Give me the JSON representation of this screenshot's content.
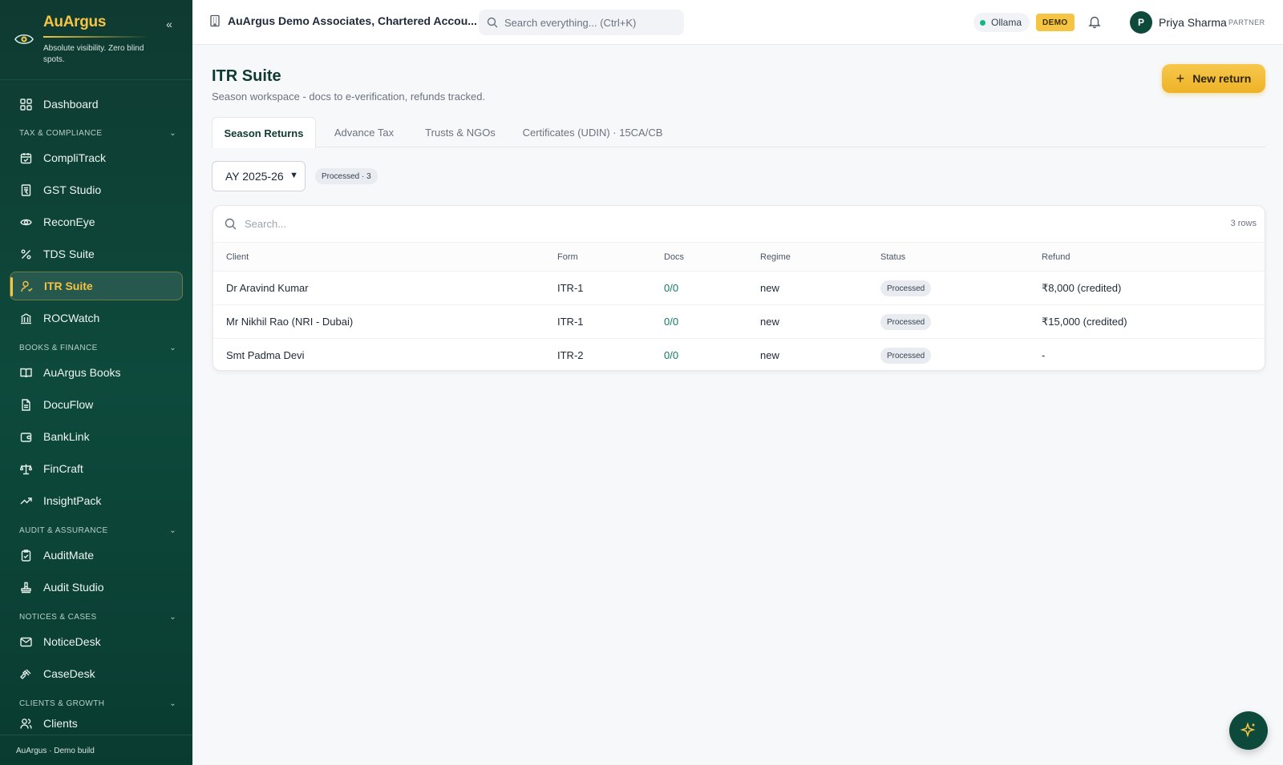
{
  "brand": {
    "name": "AuArgus",
    "tagline": "Absolute visibility. Zero blind spots.",
    "accent": "#f6c443",
    "sidebar_bg": "#0e4a3c"
  },
  "sidebar": {
    "dashboard": "Dashboard",
    "sections": [
      {
        "label": "TAX & COMPLIANCE",
        "items": [
          "CompliTrack",
          "GST Studio",
          "ReconEye",
          "TDS Suite",
          "ITR Suite",
          "ROCWatch"
        ]
      },
      {
        "label": "BOOKS & FINANCE",
        "items": [
          "AuArgus Books",
          "DocuFlow",
          "BankLink",
          "FinCraft",
          "InsightPack"
        ]
      },
      {
        "label": "AUDIT & ASSURANCE",
        "items": [
          "AuditMate",
          "Audit Studio"
        ]
      },
      {
        "label": "NOTICES & CASES",
        "items": [
          "NoticeDesk",
          "CaseDesk"
        ]
      },
      {
        "label": "CLIENTS & GROWTH",
        "items": [
          "Clients"
        ]
      }
    ],
    "active": "ITR Suite",
    "footer": "AuArgus · Demo build"
  },
  "topbar": {
    "org": "AuArgus Demo Associates, Chartered Accou...",
    "search_placeholder": "Search everything...  (Ctrl+K)",
    "ollama": "Ollama",
    "demo": "DEMO",
    "avatar_initial": "P",
    "user_name": "Priya Sharma",
    "user_role": "PARTNER"
  },
  "main": {
    "title": "ITR Suite",
    "subtitle": "Season workspace - docs to e-verification, refunds tracked.",
    "new_button": "New return",
    "tabs": [
      "Season Returns",
      "Advance Tax",
      "Trusts & NGOs",
      "Certificates (UDIN) · 15CA/CB"
    ],
    "active_tab": "Season Returns",
    "ay_select": "AY 2025-26",
    "processed_chip": "Processed · 3"
  },
  "table": {
    "search_placeholder": "Search...",
    "row_count": "3 rows",
    "columns": [
      "Client",
      "Form",
      "Docs",
      "Regime",
      "Status",
      "Refund"
    ],
    "rows": [
      {
        "client": "Dr Aravind Kumar",
        "form": "ITR-1",
        "docs": "0/0",
        "regime": "new",
        "status": "Processed",
        "refund": "₹8,000 (credited)"
      },
      {
        "client": "Mr Nikhil Rao (NRI - Dubai)",
        "form": "ITR-1",
        "docs": "0/0",
        "regime": "new",
        "status": "Processed",
        "refund": "₹15,000 (credited)"
      },
      {
        "client": "Smt Padma Devi",
        "form": "ITR-2",
        "docs": "0/0",
        "regime": "new",
        "status": "Processed",
        "refund": "-"
      }
    ]
  }
}
